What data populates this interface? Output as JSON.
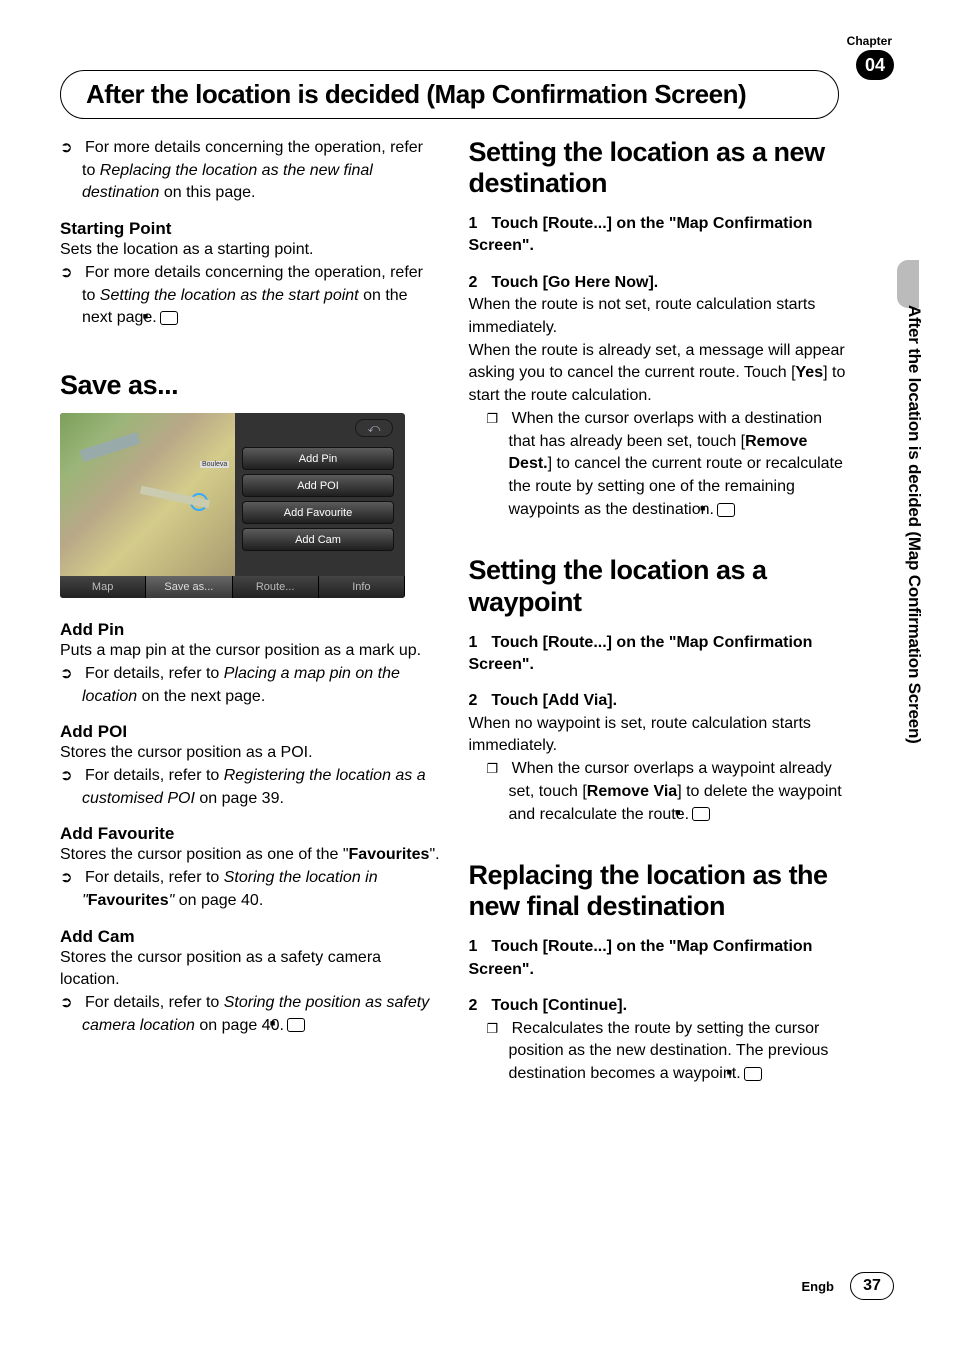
{
  "chapter": {
    "label": "Chapter",
    "number": "04"
  },
  "page_title": "After the location is decided (Map Confirmation Screen)",
  "side_title": "After the location is decided (Map Confirmation Screen)",
  "left": {
    "intro_bullet": "For more details concerning the operation, refer to ",
    "intro_ref_italic": "Replacing the location as the new final destination",
    "intro_tail": " on this page.",
    "starting_point_h": "Starting Point",
    "starting_point_desc": "Sets the location as a starting point.",
    "starting_point_bullet": "For more details concerning the operation, refer to ",
    "starting_point_ref_italic": "Setting the location as the start point",
    "starting_point_tail": " on the next page.",
    "save_as_h": "Save as...",
    "screenshot": {
      "back": "⤺",
      "menu": [
        "Add Pin",
        "Add POI",
        "Add Favourite",
        "Add Cam"
      ],
      "tabs": [
        "Map",
        "Save as...",
        "Route...",
        "Info"
      ],
      "street": "Bouleva"
    },
    "add_pin_h": "Add Pin",
    "add_pin_desc": "Puts a map pin at the cursor position as a mark up.",
    "add_pin_bullet": "For details, refer to ",
    "add_pin_ref_italic": "Placing a map pin on the location",
    "add_pin_tail": " on the next page.",
    "add_poi_h": "Add POI",
    "add_poi_desc": "Stores the cursor position as a POI.",
    "add_poi_bullet": "For details, refer to ",
    "add_poi_ref_italic": "Registering the location as a customised POI",
    "add_poi_tail": " on page 39.",
    "add_fav_h": "Add Favourite",
    "add_fav_desc_a": "Stores the cursor position as one of the \"",
    "add_fav_desc_b": "Favourites",
    "add_fav_desc_c": "\".",
    "add_fav_bullet": "For details, refer to ",
    "add_fav_ref_italic": "Storing the location in \"",
    "add_fav_ref_bold": "Favourites",
    "add_fav_ref_italic2": "\"",
    "add_fav_tail": " on page 40.",
    "add_cam_h": "Add Cam",
    "add_cam_desc": "Stores the cursor position as a safety camera location.",
    "add_cam_bullet": "For details, refer to ",
    "add_cam_ref_italic": "Storing the position as safety camera location",
    "add_cam_tail": " on page 40."
  },
  "right": {
    "sec1_h": "Setting the location as a new destination",
    "sec1_s1": "Touch [Route...] on the \"Map Confirmation Screen\".",
    "sec1_s2": "Touch [Go Here Now].",
    "sec1_p1": "When the route is not set, route calculation starts immediately.",
    "sec1_p2a": "When the route is already set, a message will appear asking you to cancel the current route. Touch [",
    "sec1_p2b": "Yes",
    "sec1_p2c": "] to start the route calculation.",
    "sec1_note_a": "When the cursor overlaps with a destination that has already been set, touch [",
    "sec1_note_b": "Remove Dest.",
    "sec1_note_c": "] to cancel the current route or recalculate the route by setting one of the remaining waypoints as the destination.",
    "sec2_h": "Setting the location as a waypoint",
    "sec2_s1": "Touch [Route...] on the \"Map Confirmation Screen\".",
    "sec2_s2": "Touch [Add Via].",
    "sec2_p1": "When no waypoint is set, route calculation starts immediately.",
    "sec2_note_a": "When the cursor overlaps a waypoint already set, touch [",
    "sec2_note_b": "Remove Via",
    "sec2_note_c": "] to delete the waypoint and recalculate the route.",
    "sec3_h": "Replacing the location as the new final destination",
    "sec3_s1": "Touch [Route...] on the \"Map Confirmation Screen\".",
    "sec3_s2": "Touch [Continue].",
    "sec3_note": "Recalculates the route by setting the cursor position as the new destination. The previous destination becomes a waypoint."
  },
  "footer": {
    "lang": "Engb",
    "page": "37"
  },
  "labels": {
    "one": "1",
    "two": "2"
  }
}
